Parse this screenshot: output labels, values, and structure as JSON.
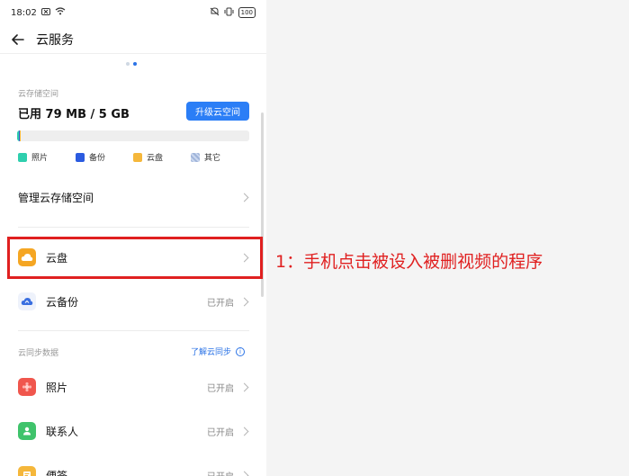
{
  "status_bar": {
    "time": "18:02",
    "battery": "100"
  },
  "app_bar": {
    "back_icon": "back-arrow-icon",
    "title": "云服务"
  },
  "storage": {
    "label": "云存储空间",
    "used_text": "已用 79 MB / 5 GB",
    "upgrade_button": "升级云空间",
    "used_fraction": 0.0155
  },
  "legend": [
    {
      "label": "照片",
      "color": "#2fcfae"
    },
    {
      "label": "备份",
      "color": "#2b5be0"
    },
    {
      "label": "云盘",
      "color": "#f5b73b"
    },
    {
      "label": "其它",
      "color": "#9fb4d9"
    }
  ],
  "rows": {
    "manage": {
      "label": "管理云存储空间"
    },
    "cloud_drive": {
      "label": "云盘",
      "icon": "cloud-drive-icon"
    },
    "cloud_backup": {
      "label": "云备份",
      "status": "已开启",
      "icon": "cloud-backup-icon"
    }
  },
  "sync_section": {
    "header": "云同步数据",
    "link": "了解云同步",
    "items": [
      {
        "label": "照片",
        "status": "已开启",
        "icon": "photos-icon",
        "color": "#f0564d"
      },
      {
        "label": "联系人",
        "status": "已开启",
        "icon": "contacts-icon",
        "color": "#3fc36b"
      },
      {
        "label": "便签",
        "status": "已开启",
        "icon": "notes-icon",
        "color": "#f5b73b"
      }
    ]
  },
  "annotation": {
    "text": "1：手机点击被设入被删视频的程序",
    "color": "#e02020"
  },
  "accent_color": "#2b7ef6"
}
